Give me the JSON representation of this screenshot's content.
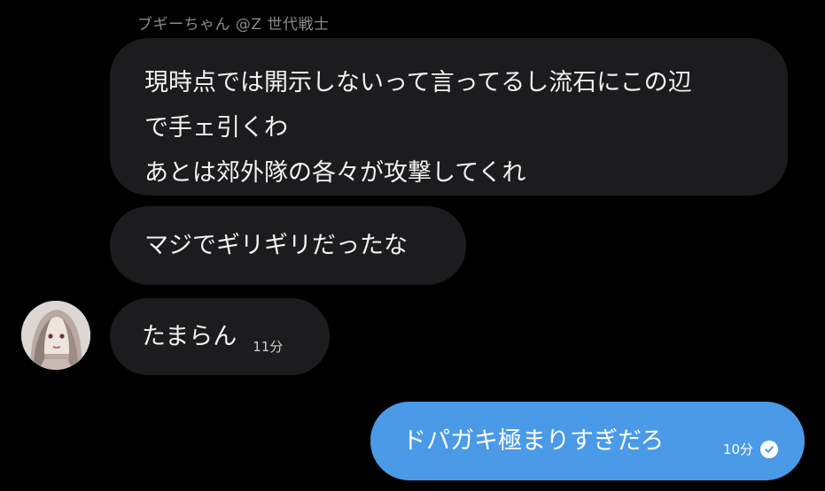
{
  "conversation": {
    "sender_name": "ブギーちゃん @Z 世代戦士",
    "incoming": [
      {
        "lines": [
          "現時点では開示しないって言ってるし流石にこの辺",
          "で手ェ引くわ",
          "あとは郊外隊の各々が攻撃してくれ"
        ]
      },
      {
        "lines": [
          "マジでギリギリだったな"
        ]
      },
      {
        "text": "たまらん",
        "time": "11分"
      }
    ],
    "outgoing": {
      "text": "ドパガキ極まりすぎだろ",
      "time": "10分",
      "status_icon": "read-check-icon"
    }
  },
  "colors": {
    "background": "#000000",
    "incoming_bubble": "#1c1c1e",
    "outgoing_bubble": "#4a9ae8",
    "sender_name": "#8a8a8a"
  }
}
